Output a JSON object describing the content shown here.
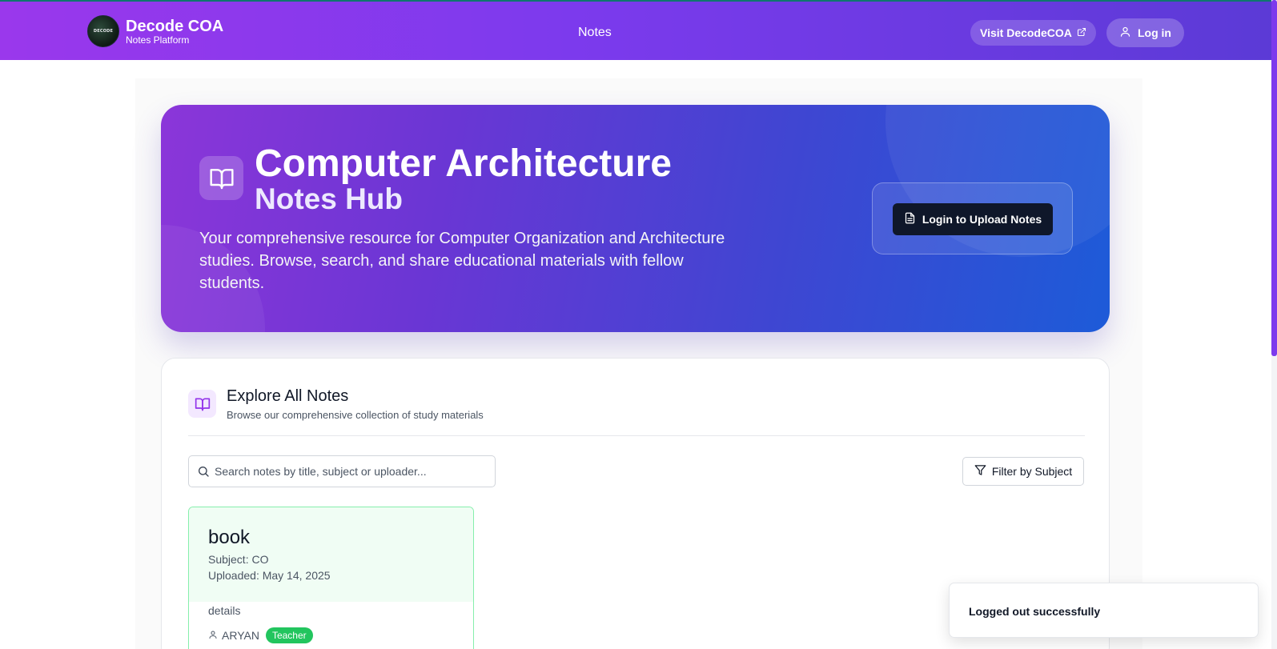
{
  "navbar": {
    "brand_title": "Decode COA",
    "brand_subtitle": "Notes Platform",
    "logo_text": "DECODE",
    "nav_link": "Notes",
    "visit_label": "Visit DecodeCOA",
    "login_label": "Log in",
    "accent_color": "#7c3aed"
  },
  "hero": {
    "title": "Computer Architecture",
    "subtitle": "Notes Hub",
    "description": "Your comprehensive resource for Computer Organization and Architecture studies. Browse, search, and share educational materials with fellow students.",
    "upload_button": "Login to Upload Notes",
    "icon": "book-open-icon"
  },
  "explore": {
    "title": "Explore All Notes",
    "subtitle": "Browse our comprehensive collection of study materials",
    "search_placeholder": "Search notes by title, subject or uploader...",
    "filter_label": "Filter by Subject"
  },
  "notes": [
    {
      "title": "book",
      "subject": "Subject: CO",
      "uploaded": "Uploaded: May 14, 2025",
      "details": "details",
      "uploader": "ARYAN",
      "role": "Teacher",
      "role_color": "#22c55e"
    }
  ],
  "toast": {
    "message": "Logged out successfully"
  }
}
